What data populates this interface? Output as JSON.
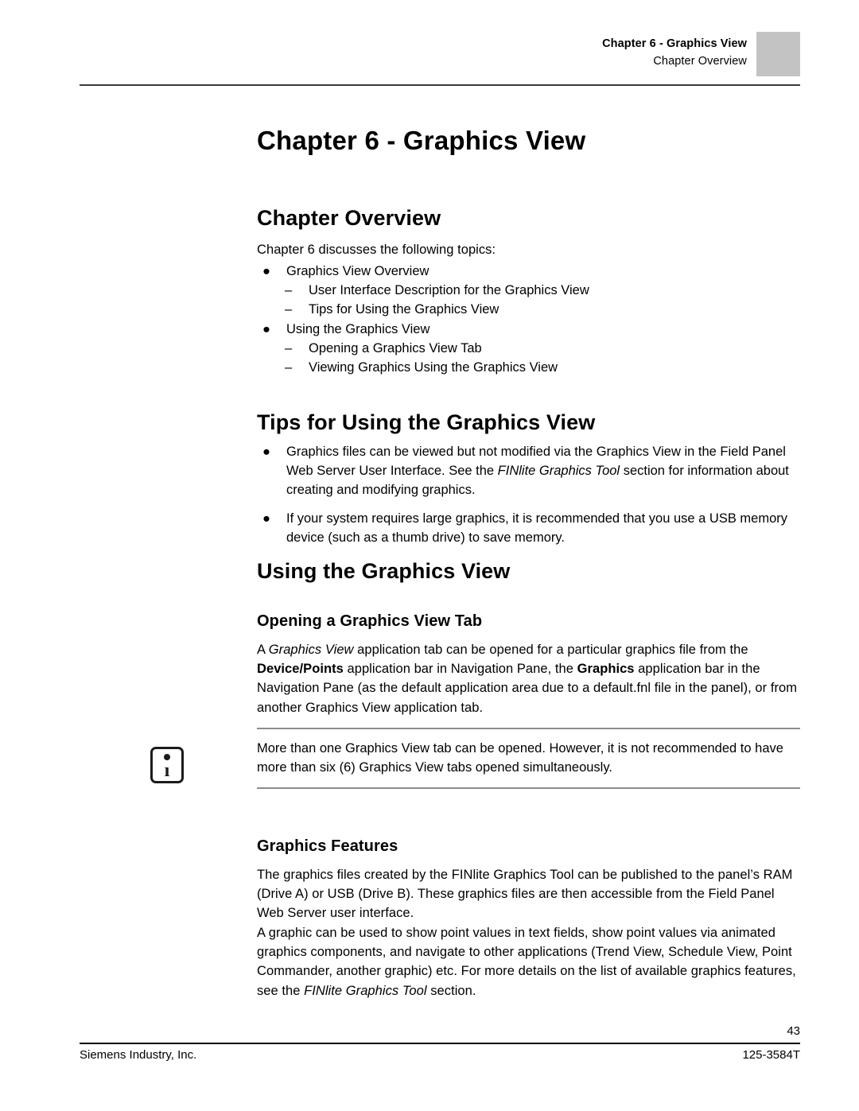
{
  "header": {
    "line1": "Chapter 6 - Graphics View",
    "line2": "Chapter Overview",
    "box_color": "#c3c3c3"
  },
  "chapter_title": "Chapter 6 - Graphics View",
  "chapter_overview": {
    "heading": "Chapter Overview",
    "intro": "Chapter 6 discusses the following topics:",
    "items": [
      {
        "level": 1,
        "marker": "●",
        "label": "Graphics View Overview",
        "children": [
          {
            "level": 2,
            "marker": "–",
            "label": "User Interface Description for the Graphics View"
          },
          {
            "level": 2,
            "marker": "–",
            "label": "Tips for Using the Graphics View"
          }
        ]
      },
      {
        "level": 1,
        "marker": "●",
        "label": "Using the Graphics View",
        "children": [
          {
            "level": 2,
            "marker": "–",
            "label": "Opening a Graphics View Tab"
          },
          {
            "level": 2,
            "marker": "–",
            "label": "Viewing Graphics Using the Graphics View"
          }
        ]
      }
    ]
  },
  "tips": {
    "heading": "Tips for Using the Graphics View",
    "bullets": [
      {
        "marker": "●",
        "parts": [
          {
            "text": "Graphics files can be viewed but not modified via the Graphics View in the Field Panel Web Server User Interface. See the ",
            "style": "normal"
          },
          {
            "text": "FINlite Graphics Tool",
            "style": "italic"
          },
          {
            "text": " section for information about creating and modifying graphics.",
            "style": "normal"
          }
        ]
      },
      {
        "marker": "●",
        "parts": [
          {
            "text": "If your system requires large graphics, it is recommended that you use a USB memory device (such as a thumb drive) to save memory.",
            "style": "normal"
          }
        ]
      }
    ]
  },
  "using": {
    "heading": "Using the Graphics View",
    "opening_tab": {
      "heading": "Opening a Graphics View Tab",
      "parts": [
        {
          "text": "A ",
          "style": "normal"
        },
        {
          "text": "Graphics View",
          "style": "italic"
        },
        {
          "text": " application tab can be opened for a particular graphics file from the ",
          "style": "normal"
        },
        {
          "text": "Device/Points",
          "style": "bold"
        },
        {
          "text": " application bar in Navigation Pane, the ",
          "style": "normal"
        },
        {
          "text": "Graphics",
          "style": "bold"
        },
        {
          "text": " application bar in the Navigation Pane (as the default application area due to a default.fnl file in the panel), or from another Graphics View application tab.",
          "style": "normal"
        }
      ]
    },
    "note": {
      "icon": "info-icon",
      "text": "More than one Graphics View tab can be opened. However, it is not recommended to have more than six (6) Graphics View tabs opened simultaneously."
    },
    "features": {
      "heading": "Graphics Features",
      "paragraph1": "The graphics files created by the FINlite Graphics Tool can be published to the panel’s RAM (Drive A) or USB (Drive B). These graphics files are then accessible from the Field Panel Web Server user interface.",
      "paragraph2_parts": [
        {
          "text": "A graphic can be used to show point values in text fields, show point values via animated graphics components, and navigate to other applications (Trend View, Schedule View, Point Commander, another graphic) etc. For more details on the list of available graphics features, see the ",
          "style": "normal"
        },
        {
          "text": "FINlite Graphics Tool",
          "style": "italic"
        },
        {
          "text": " section.",
          "style": "normal"
        }
      ]
    }
  },
  "footer": {
    "page_number": "43",
    "company": "Siemens Industry, Inc.",
    "document_number": "125-3584T"
  }
}
